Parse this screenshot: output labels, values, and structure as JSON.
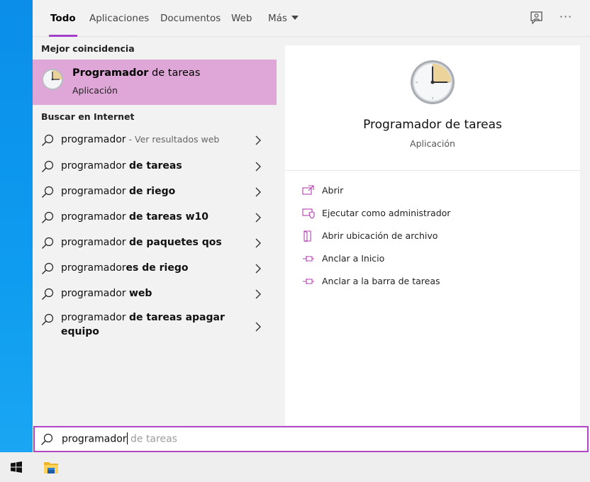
{
  "tabs": {
    "items": [
      {
        "label": "Todo",
        "active": true
      },
      {
        "label": "Aplicaciones",
        "active": false
      },
      {
        "label": "Documentos",
        "active": false
      },
      {
        "label": "Web",
        "active": false
      },
      {
        "label": "Más",
        "active": false
      }
    ],
    "feedback_icon": "feedback-icon",
    "more_options_glyph": "···"
  },
  "results": {
    "best_match_heading": "Mejor coincidencia",
    "best_match": {
      "title_bold": "Programador",
      "title_rest": " de tareas",
      "subtitle": "Aplicación",
      "icon": "clock-icon"
    },
    "web_heading": "Buscar en Internet",
    "web_items": [
      {
        "normal": "programador",
        "bold": "",
        "hint": " - Ver resultados web"
      },
      {
        "normal": "programador ",
        "bold": "de tareas",
        "hint": ""
      },
      {
        "normal": "programador ",
        "bold": "de riego",
        "hint": ""
      },
      {
        "normal": "programador ",
        "bold": "de tareas w10",
        "hint": ""
      },
      {
        "normal": "programador ",
        "bold": "de paquetes qos",
        "hint": ""
      },
      {
        "normal": "programador",
        "bold": "es de riego",
        "hint": ""
      },
      {
        "normal": "programador ",
        "bold": "web",
        "hint": ""
      },
      {
        "normal": "programador ",
        "bold": "de tareas apagar equipo",
        "hint": ""
      }
    ]
  },
  "preview": {
    "title": "Programador de tareas",
    "subtitle": "Aplicación",
    "actions": [
      {
        "label": "Abrir",
        "icon": "open-icon"
      },
      {
        "label": "Ejecutar como administrador",
        "icon": "run-as-admin-icon"
      },
      {
        "label": "Abrir ubicación de archivo",
        "icon": "file-location-icon"
      },
      {
        "label": "Anclar a Inicio",
        "icon": "pin-icon"
      },
      {
        "label": "Anclar a la barra de tareas",
        "icon": "pin-icon"
      }
    ]
  },
  "search": {
    "typed": "programador",
    "suggestion": " de tareas"
  },
  "colors": {
    "accent": "#a33fc9",
    "selection": "#dfa6d8",
    "action_icon": "#b43fb0"
  }
}
